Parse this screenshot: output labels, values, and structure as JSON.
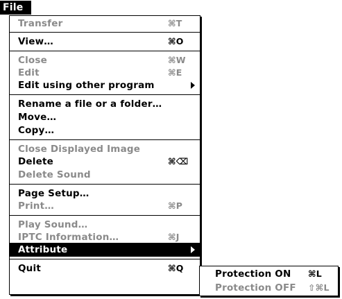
{
  "menu_title": "File",
  "items": [
    {
      "label": "Transfer",
      "shortcut": "⌘T"
    },
    {
      "label": "View…",
      "shortcut": "⌘O"
    },
    {
      "label": "Close",
      "shortcut": "⌘W"
    },
    {
      "label": "Edit",
      "shortcut": "⌘E"
    },
    {
      "label": "Edit using other program"
    },
    {
      "label": "Rename a file or a folder…"
    },
    {
      "label": "Move…"
    },
    {
      "label": "Copy…"
    },
    {
      "label": "Close Displayed Image"
    },
    {
      "label": "Delete",
      "shortcut": "⌘⌫"
    },
    {
      "label": "Delete Sound"
    },
    {
      "label": "Page Setup…"
    },
    {
      "label": "Print…",
      "shortcut": "⌘P"
    },
    {
      "label": "Play Sound…"
    },
    {
      "label": "IPTC Information…",
      "shortcut": "⌘J"
    },
    {
      "label": "Attribute"
    },
    {
      "label": "Quit",
      "shortcut": "⌘Q"
    }
  ],
  "submenu": [
    {
      "label": "Protection ON",
      "shortcut": "⌘L"
    },
    {
      "label": "Protection OFF",
      "shortcut": "⇧⌘L"
    }
  ],
  "colors": {
    "highlight": "#000000",
    "disabled_text": "#8a8a8a"
  }
}
